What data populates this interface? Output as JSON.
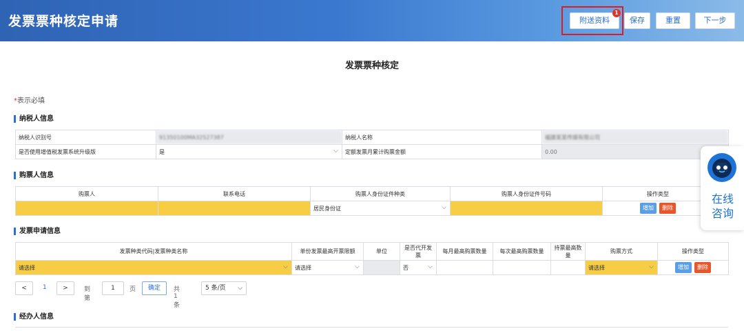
{
  "header": {
    "title": "发票票种核定申请",
    "buttons": {
      "attach": "附送资料",
      "attach_badge": "1",
      "save": "保存",
      "reset": "重置",
      "next": "下一步"
    }
  },
  "page": {
    "title": "发票票种核定",
    "required_note": "表示必填",
    "required_star": "*"
  },
  "taxpayer": {
    "section_title": "纳税人信息",
    "id_label": "纳税人识别号",
    "id_value": "91350100MA32527387",
    "name_label": "纳税人名称",
    "name_value": "福建某某传媒有限公司",
    "upgrade_label": "是否使用增值税发票系统升级版",
    "upgrade_value": "是",
    "amount_label": "定额发票月累计购票金额",
    "amount_value": "0.00"
  },
  "buyer": {
    "section_title": "购票人信息",
    "headers": [
      "购票人",
      "联系电话",
      "购票人身份证件种类",
      "购票人身份证件号码",
      "操作类型"
    ],
    "id_type_value": "居民身份证",
    "add_label": "增加",
    "delete_label": "删除"
  },
  "invoice": {
    "section_title": "发票申请信息",
    "headers": [
      "发票种类代码|发票种类名称",
      "单份发票最高开票限额",
      "单位",
      "是否代开发票",
      "每月最高购票数量",
      "每次最高购票数量",
      "持票最高数量",
      "购票方式",
      "操作类型"
    ],
    "type_value": "请选择",
    "limit_value": "请选择",
    "agent_value": "否",
    "method_value": "请选择",
    "add_label": "增加",
    "delete_label": "删除"
  },
  "pager": {
    "prev": "<",
    "current": "1",
    "next": ">",
    "goto_label": "到第",
    "goto_value": "1",
    "page_unit": "页",
    "confirm": "确定",
    "total": "共 1 条",
    "page_size": "5 条/页"
  },
  "agent": {
    "section_title": "经办人信息"
  },
  "consult": {
    "label": "在线咨询"
  },
  "colors": {
    "accent": "#2d6fd0",
    "header_bg": "#3a78cf",
    "required_fill": "#f6cd45",
    "delete": "#e8562c",
    "add": "#5a9fe6",
    "highlight": "#d81d24"
  }
}
